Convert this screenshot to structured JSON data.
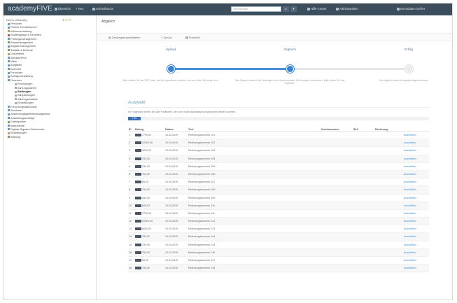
{
  "app": {
    "logo_text": "academyFIVE",
    "colors": {
      "topbar": "#3c4d5c",
      "accent": "#3b82d1",
      "link": "#3b8dd0"
    }
  },
  "topbar": {
    "items": [
      "Übersicht",
      "+ Neu",
      "Schnellsuche"
    ],
    "search_placeholder": "Schnellsuche",
    "right_items": [
      "Hilfe-Center",
      "Administration",
      "Demodaten GmbH"
    ]
  },
  "sidebar": {
    "header": "Demo University",
    "header_tools": "⊕ ⊖ ⟲",
    "items": [
      {
        "label": "Personen",
        "indent": 0,
        "color": "#5a9bd4"
      },
      {
        "label": "Partner & Institutionen",
        "indent": 0,
        "color": "#5a9bd4"
      },
      {
        "label": "Adressverwaltung",
        "indent": 0,
        "color": "#c9a13b"
      },
      {
        "label": "Studiengänge & Einheiten",
        "indent": 0,
        "color": "#d04b4b"
      },
      {
        "label": "Prüfungsmanagement",
        "indent": 0,
        "color": "#5a9bd4"
      },
      {
        "label": "Raummanagement",
        "indent": 0,
        "color": "#6aa84f"
      },
      {
        "label": "Abgabe Management",
        "indent": 0,
        "color": "#5a9bd4"
      },
      {
        "label": "Statistik & Berichte",
        "indent": 0,
        "color": "#6aa84f"
      },
      {
        "label": "Dokumente",
        "indent": 0,
        "color": "#c9a13b"
      },
      {
        "label": "Website/Print",
        "indent": 0,
        "color": "#5a9bd4"
      },
      {
        "label": "Mails",
        "indent": 0,
        "color": "#5a9bd4"
      },
      {
        "label": "Aufgaben",
        "indent": 0,
        "color": "#5a9bd4"
      },
      {
        "label": "Kalender",
        "indent": 0,
        "color": "#5a9bd4"
      },
      {
        "label": "Formulare",
        "indent": 0,
        "color": "#5a9bd4"
      },
      {
        "label": "Anfrageverwaltung",
        "indent": 0,
        "color": "#5a9bd4"
      },
      {
        "label": "Finanzen",
        "indent": 0,
        "color": "#5a9bd4"
      },
      {
        "label": "Rechnungen",
        "indent": 1,
        "color": "#aaaaaa"
      },
      {
        "label": "Zahlungsplanen",
        "indent": 1,
        "color": "#aaaaaa"
      },
      {
        "label": "Stellungen",
        "indent": 1,
        "color": "#aaaaaa",
        "active": true
      },
      {
        "label": "Zahlplanungen",
        "indent": 1,
        "color": "#aaaaaa"
      },
      {
        "label": "Zahlungsmodelle",
        "indent": 1,
        "color": "#aaaaaa"
      },
      {
        "label": "Einstellungen",
        "indent": 1,
        "color": "#aaaaaa"
      },
      {
        "label": "Forschungsdatenbank",
        "indent": 0,
        "color": "#5a9bd4"
      },
      {
        "label": "Seminare",
        "indent": 0,
        "color": "#5a9bd4"
      },
      {
        "label": "Anwendungsgebietsmanagement",
        "indent": 0,
        "color": "#5a9bd4"
      },
      {
        "label": "Ausbildungsverträge",
        "indent": 0,
        "color": "#5a9bd4"
      },
      {
        "label": "Datenquellen",
        "indent": 0,
        "color": "#6aa84f"
      },
      {
        "label": "Instrumente",
        "indent": 0,
        "color": "#5a9bd4"
      },
      {
        "label": "Digitale Signatur-Dokumente",
        "indent": 0,
        "color": "#5a9bd4"
      },
      {
        "label": "Einstellungen",
        "indent": 0,
        "color": "#c9a13b"
      },
      {
        "label": "Wartung",
        "indent": 0,
        "color": "#6aa84f"
      }
    ]
  },
  "main": {
    "breadcrumb": "Abgleich",
    "sub_buttons": [
      "Zahlungsimportdateien",
      "+ Zurück",
      "Protokoll"
    ]
  },
  "stepper": {
    "steps": [
      {
        "label": "Upload",
        "desc": "Bitte wählen Sie die CSV-Datei, die Sie importieren möchten aus und laden Sie diese hoch.",
        "done": true
      },
      {
        "label": "Abgleich",
        "desc": "Das System versucht die Zahlungen den entsprechenden Rechnungen zuzuordnen. Bitte prüfen Sie das Ergebnis.",
        "done": true
      },
      {
        "label": "Erfolg",
        "desc": "Der Abgleich wurde erfolgreich abgeschlossen.",
        "done": false
      }
    ]
  },
  "panel": {
    "title": "Auswahl",
    "text": "Im Folgenden sehen Sie alle Positionen, die noch nicht automatisch zugeordnet werden konnten.",
    "badge": "1/18"
  },
  "table": {
    "headers": [
      "ID",
      "Betrag",
      "Datum",
      "Text",
      "Kontonummer",
      "BLZ",
      "Rechnung",
      ""
    ],
    "rows": [
      [
        "1",
        "7795,00",
        "10.04.2019",
        "Rechnungsnummer 101",
        "Auswählen"
      ],
      [
        "2",
        "12000,00",
        "10.04.2019",
        "Rechnungsnummer 102",
        "Auswählen"
      ],
      [
        "3",
        "5000,00",
        "10.04.2019",
        "Rechnungsnummer 103",
        "Auswählen"
      ],
      [
        "4",
        "750,00",
        "10.04.2019",
        "Rechnungsnummer 104",
        "Auswählen"
      ],
      [
        "5",
        "750,00",
        "10.04.2019",
        "Rechnungsnummer 105",
        "Auswählen"
      ],
      [
        "6",
        "750,00",
        "10.04.2019",
        "Rechnungsnummer 106",
        "Auswählen"
      ],
      [
        "7",
        "95,00",
        "10.04.2019",
        "Rechnungsnummer 107",
        "Auswählen"
      ],
      [
        "8",
        "750,00",
        "10.04.2019",
        "Rechnungsnummer 108",
        "Auswählen"
      ],
      [
        "9",
        "250,00",
        "10.04.2019",
        "Rechnungsnummer 109",
        "Auswählen"
      ],
      [
        "10",
        "695,00",
        "10.04.2019",
        "Rechnungsnummer 110",
        "Auswählen"
      ],
      [
        "11",
        "7795,00",
        "10.04.2019",
        "Rechnungsnummer 111",
        "Auswählen"
      ],
      [
        "12",
        "12000,00",
        "10.04.2019",
        "Rechnungsnummer 112",
        "Auswählen"
      ],
      [
        "13",
        "5000,00",
        "10.04.2019",
        "Rechnungsnummer 113",
        "Auswählen"
      ],
      [
        "14",
        "750,00",
        "10.04.2019",
        "Rechnungsnummer 114",
        "Auswählen"
      ],
      [
        "15",
        "750,00",
        "10.04.2019",
        "Rechnungsnummer 115",
        "Auswählen"
      ],
      [
        "16",
        "750,00",
        "10.04.2019",
        "Rechnungsnummer 116",
        "Auswählen"
      ],
      [
        "17",
        "95,00",
        "10.04.2019",
        "Rechnungsnummer 117",
        "Auswählen"
      ],
      [
        "18",
        "750,00",
        "10.04.2019",
        "Rechnungsnummer 118",
        "Auswählen"
      ]
    ]
  }
}
